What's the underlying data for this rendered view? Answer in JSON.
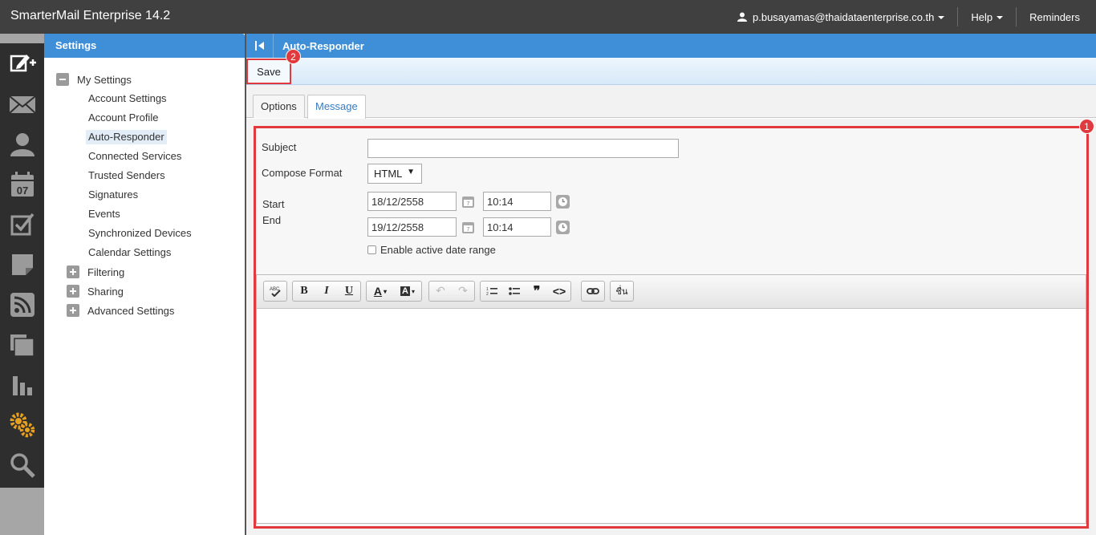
{
  "app": {
    "title": "SmarterMail Enterprise 14.2"
  },
  "topnav": {
    "user": "p.busayamas@thaidataenterprise.co.th",
    "help": "Help",
    "reminders": "Reminders"
  },
  "rail": {
    "icons": [
      "compose-icon",
      "mail-icon",
      "contacts-icon",
      "calendar-icon",
      "tasks-icon",
      "notes-icon",
      "rss-icon",
      "files-icon",
      "reports-icon",
      "settings-icon",
      "search-icon"
    ],
    "calendar_day": "07"
  },
  "settings": {
    "header": "Settings",
    "root": "My Settings",
    "items": [
      {
        "label": "Account Settings"
      },
      {
        "label": "Account Profile"
      },
      {
        "label": "Auto-Responder"
      },
      {
        "label": "Connected Services"
      },
      {
        "label": "Trusted Senders"
      },
      {
        "label": "Signatures"
      },
      {
        "label": "Events"
      },
      {
        "label": "Synchronized Devices"
      },
      {
        "label": "Calendar Settings"
      }
    ],
    "groups": [
      {
        "label": "Filtering"
      },
      {
        "label": "Sharing"
      },
      {
        "label": "Advanced Settings"
      }
    ]
  },
  "main": {
    "title": "Auto-Responder",
    "save_label": "Save",
    "tabs": [
      {
        "label": "Options"
      },
      {
        "label": "Message"
      }
    ],
    "form": {
      "subject_label": "Subject",
      "subject_value": "",
      "compose_format_label": "Compose Format",
      "compose_format_value": "HTML",
      "start_label": "Start",
      "end_label": "End",
      "start_date": "18/12/2558",
      "start_time": "10:14",
      "end_date": "19/12/2558",
      "end_time": "10:14",
      "enable_range_label": "Enable active date range"
    },
    "editor": {
      "thai_button": "ชื่น",
      "message_body": ""
    },
    "badges": {
      "frame": "1",
      "save": "2"
    }
  },
  "colors": {
    "topbar": "#404040",
    "accent": "#3e8fd8",
    "highlight": "#e0393e"
  }
}
